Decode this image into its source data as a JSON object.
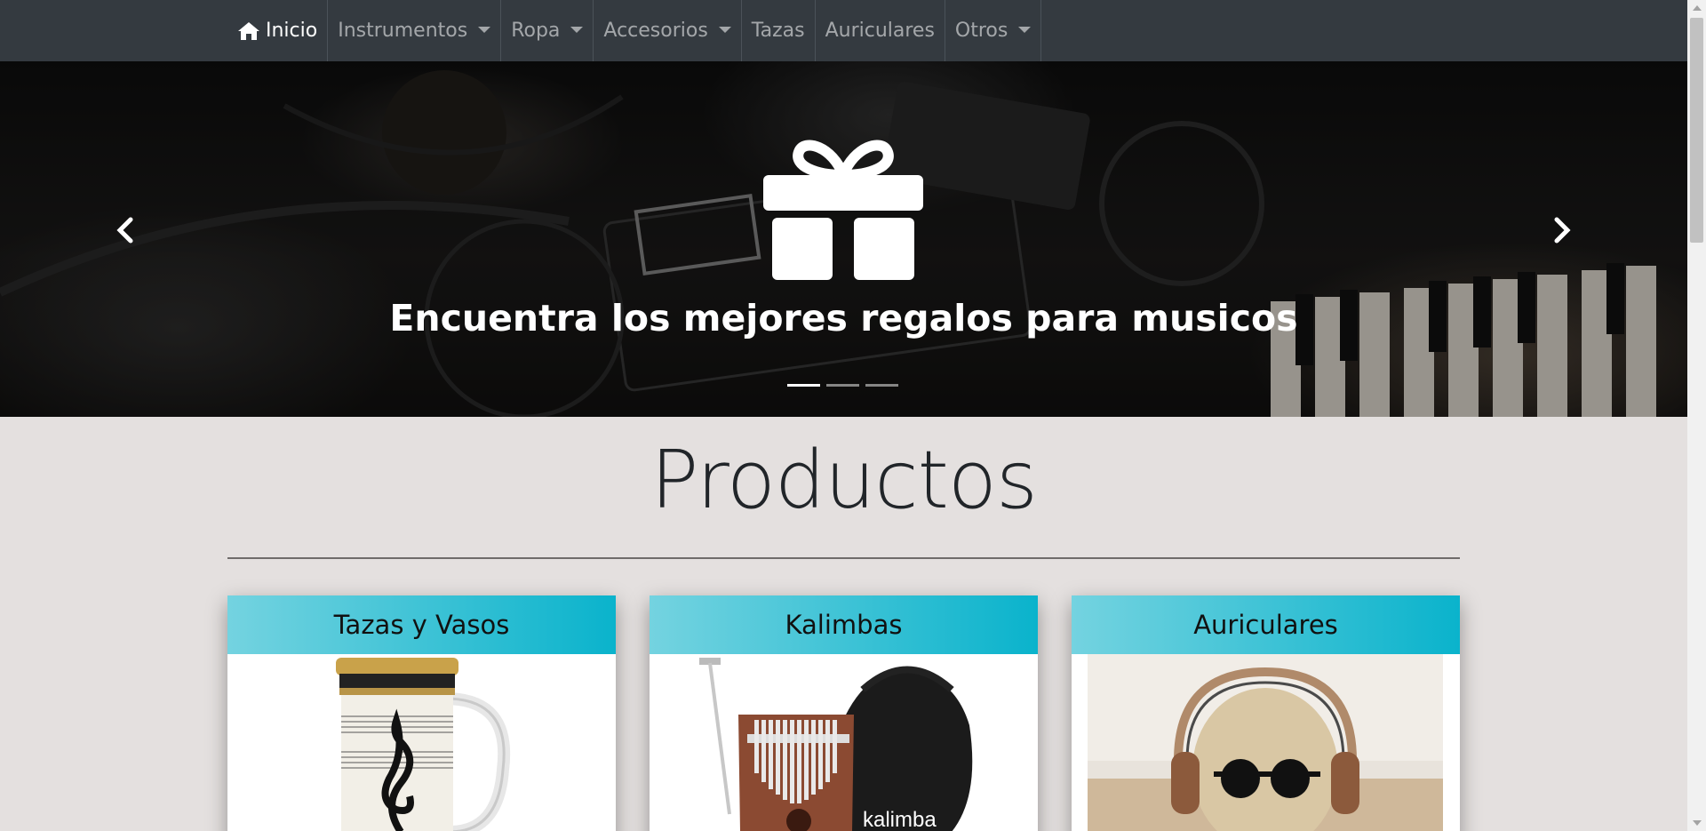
{
  "nav": {
    "items": [
      {
        "label": "Inicio",
        "icon": "home-icon",
        "active": true,
        "dropdown": false
      },
      {
        "label": "Instrumentos",
        "dropdown": true
      },
      {
        "label": "Ropa",
        "dropdown": true
      },
      {
        "label": "Accesorios",
        "dropdown": true
      },
      {
        "label": "Tazas",
        "dropdown": false
      },
      {
        "label": "Auriculares",
        "dropdown": false
      },
      {
        "label": "Otros",
        "dropdown": true
      }
    ]
  },
  "carousel": {
    "icon": "gift-icon",
    "caption": "Encuentra los mejores regalos para musicos",
    "slides": 3,
    "active_slide": 1
  },
  "products": {
    "title": "Productos",
    "cards": [
      {
        "title": "Tazas y Vasos",
        "image": "treble-clef-travel-mug"
      },
      {
        "title": "Kalimbas",
        "image": "kalimba-with-case",
        "image_text": "kalimba"
      },
      {
        "title": "Auriculares",
        "image": "skull-with-headphones"
      }
    ]
  },
  "colors": {
    "navbar": "#343a40",
    "page_bg": "#e4e0df",
    "card_header_start": "#74d3e0",
    "card_header_end": "#0ab3cc"
  }
}
